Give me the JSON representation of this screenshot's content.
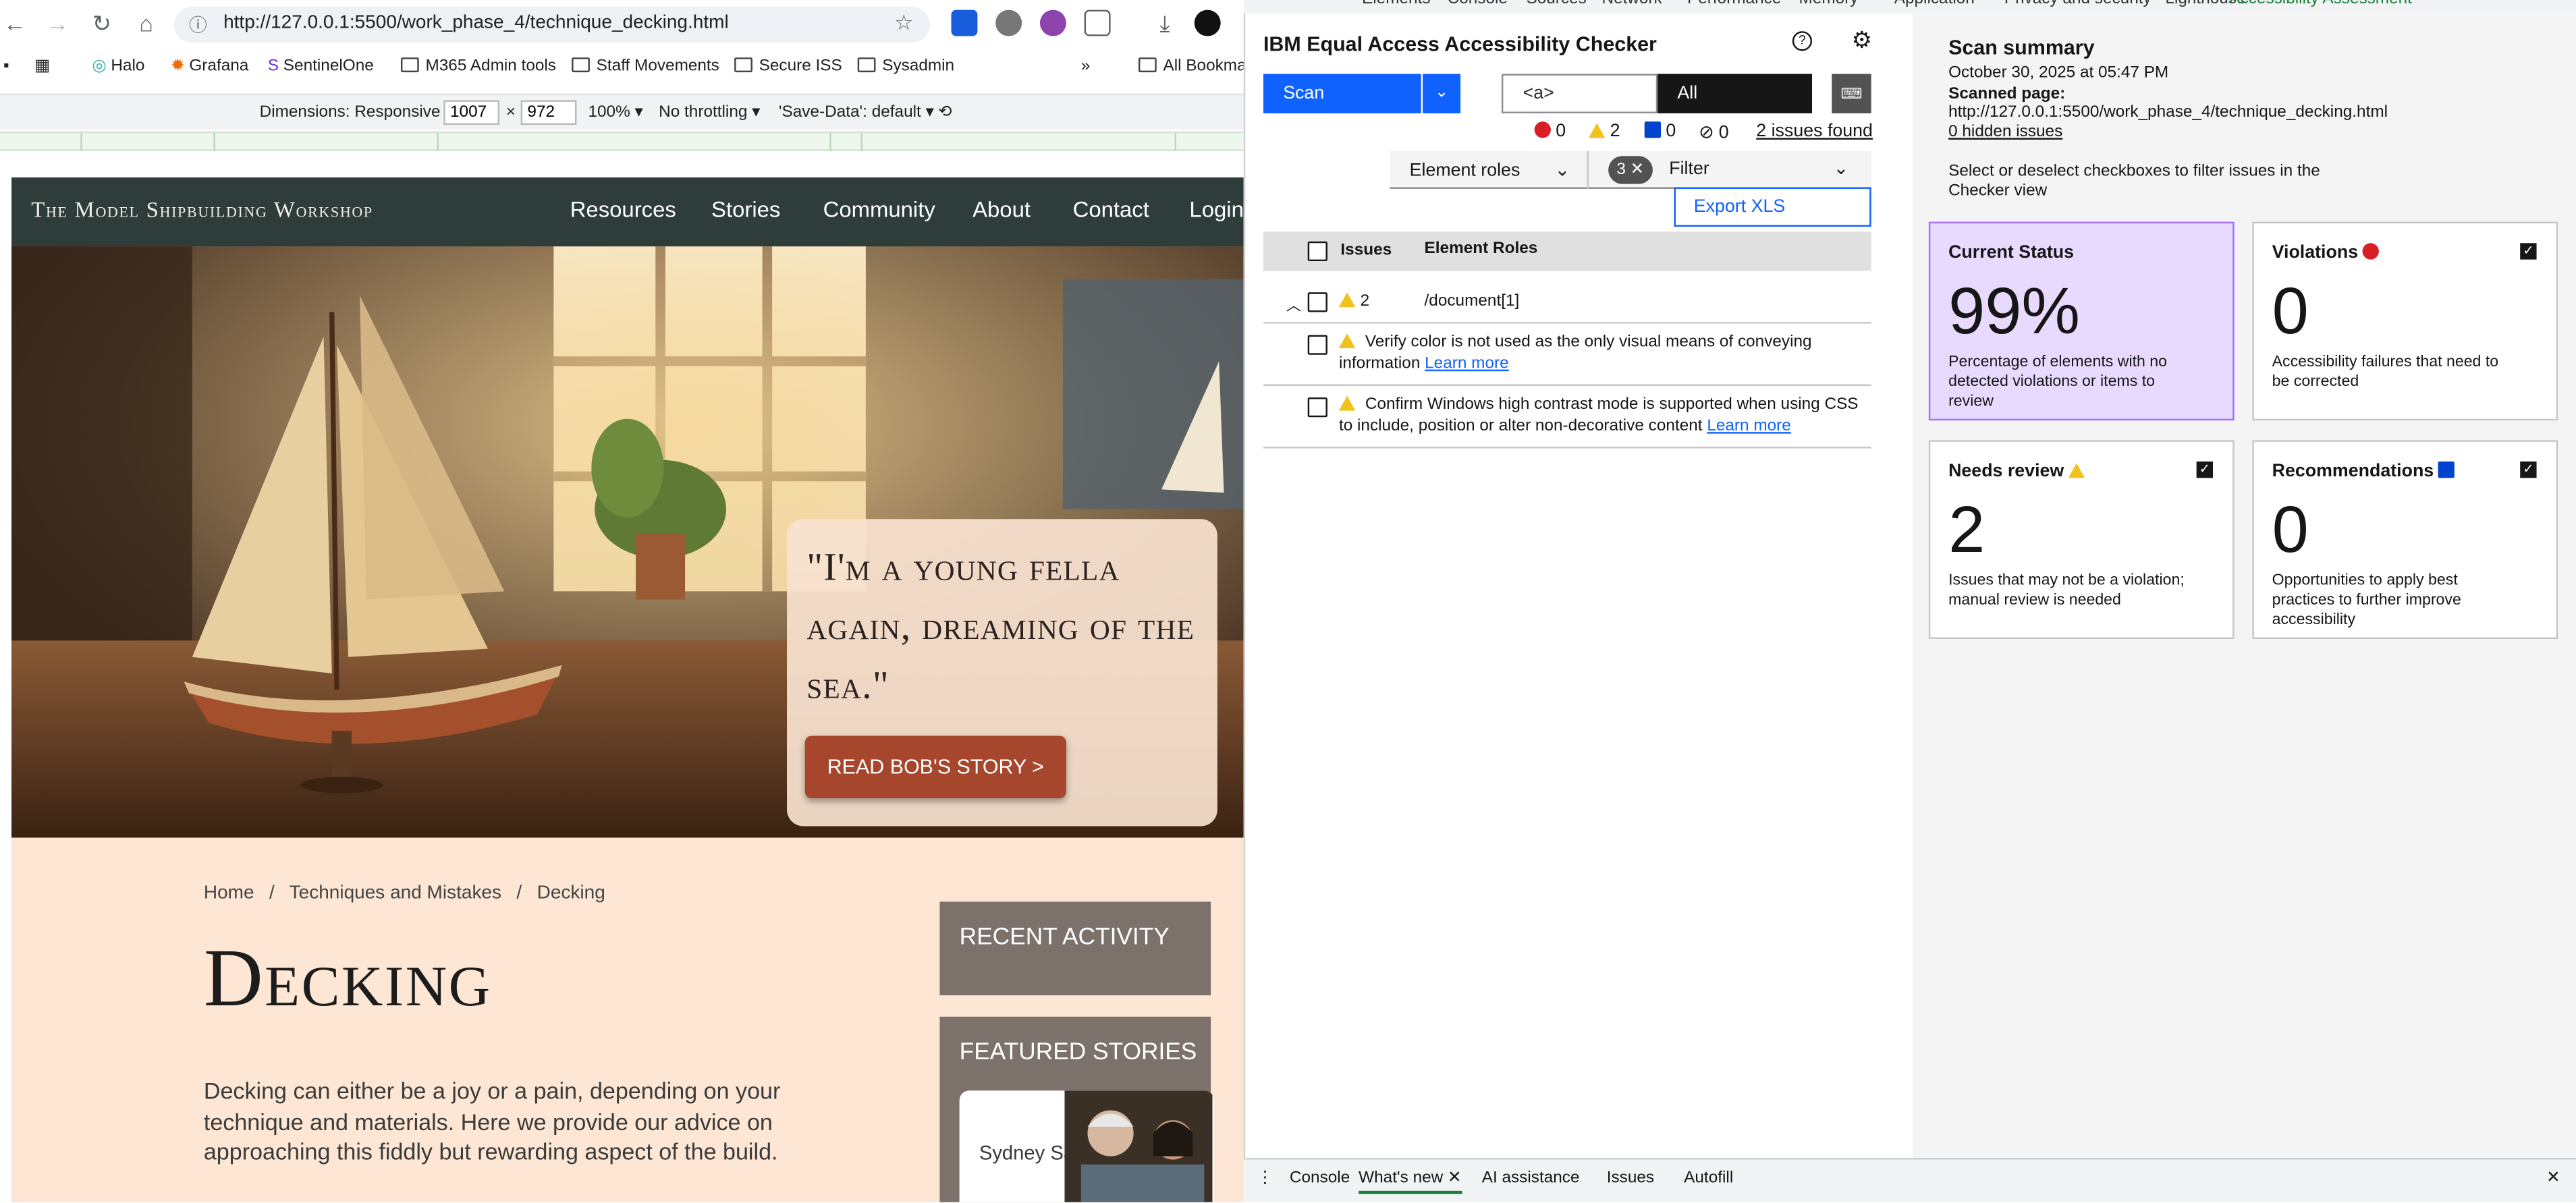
{
  "browser": {
    "url": "http://127.0.0.1:5500/work_phase_4/technique_decking.html",
    "bookmarks": [
      "Halo",
      "Grafana",
      "SentinelOne",
      "M365 Admin tools",
      "Staff Movements",
      "Secure ISS",
      "Sysadmin",
      "All Bookma"
    ],
    "more": "»"
  },
  "device_toolbar": {
    "dimensions_label": "Dimensions: Responsive",
    "width": "1007",
    "times": "×",
    "height": "972",
    "zoom": "100%",
    "throttling": "No throttling",
    "save_data": "'Save-Data': default"
  },
  "site": {
    "title": "The Model Shipbuilding Workshop",
    "nav": [
      "Resources",
      "Stories",
      "Community",
      "About",
      "Contact",
      "Login"
    ],
    "hero_quote": "\"I'm a young fella again, dreaming of the sea.\"",
    "hero_button": "READ BOB'S STORY >",
    "breadcrumb": [
      "Home",
      "Techniques and Mistakes",
      "Decking"
    ],
    "breadcrumb_sep": "/",
    "heading": "Decking",
    "intro": "Decking can either be a joy or a pain, depending on your technique and materials. Here we provide our advice on approaching this fiddly but rewarding aspect of the build.",
    "recent_activity": "RECENT ACTIVITY",
    "featured_stories": "FEATURED STORIES",
    "featured_card_name": "Sydney Sails"
  },
  "devtools": {
    "tabs": [
      "Elements",
      "Console",
      "Sources",
      "Network",
      "Performance",
      "Memory",
      "Application",
      "Privacy and security",
      "Lighthouse",
      "Accessibility Assessment"
    ],
    "drawer_tabs": [
      "Console",
      "What's new",
      "AI assistance",
      "Issues",
      "Autofill"
    ]
  },
  "checker": {
    "title": "IBM Equal Access Accessibility Checker",
    "scan": "Scan",
    "element_input": "<a>",
    "scope": "All",
    "counts": {
      "violations": "0",
      "needs_review": "2",
      "recommendations": "0",
      "hidden": "0"
    },
    "issues_found": "2 issues found",
    "element_roles": "Element roles",
    "filter_count": "3",
    "filter": "Filter",
    "export": "Export XLS",
    "col_issues": "Issues",
    "col_roles": "Element Roles",
    "group_count": "2",
    "group_role": "/document[1]",
    "learn_more": "Learn more",
    "issues": [
      "Verify color is not used as the only visual means of conveying information",
      "Confirm Windows high contrast mode is supported when using CSS to include, position or alter non-decorative content"
    ]
  },
  "summary": {
    "heading": "Scan summary",
    "date": "October 30, 2025 at 05:47 PM",
    "scanned_label": "Scanned page:",
    "scanned_url": "http://127.0.0.1:5500/work_phase_4/technique_decking.html",
    "hidden_issues": "0 hidden issues",
    "hint": "Select or deselect checkboxes to filter issues in the Checker view",
    "cards": [
      {
        "title": "Current Status",
        "value": "99%",
        "desc": "Percentage of elements with no detected violations or items to review"
      },
      {
        "title": "Violations",
        "value": "0",
        "desc": "Accessibility failures that need to be corrected"
      },
      {
        "title": "Needs review",
        "value": "2",
        "desc": "Issues that may not be a violation; manual review is needed"
      },
      {
        "title": "Recommendations",
        "value": "0",
        "desc": "Opportunities to apply best practices to further improve accessibility"
      }
    ]
  },
  "colors": {
    "accent": "#0f62fe",
    "status_card": "#e8daff",
    "hero_button": "#a6462c",
    "page_bg": "#fde7d4",
    "nav_bg": "#2f3d3a"
  }
}
